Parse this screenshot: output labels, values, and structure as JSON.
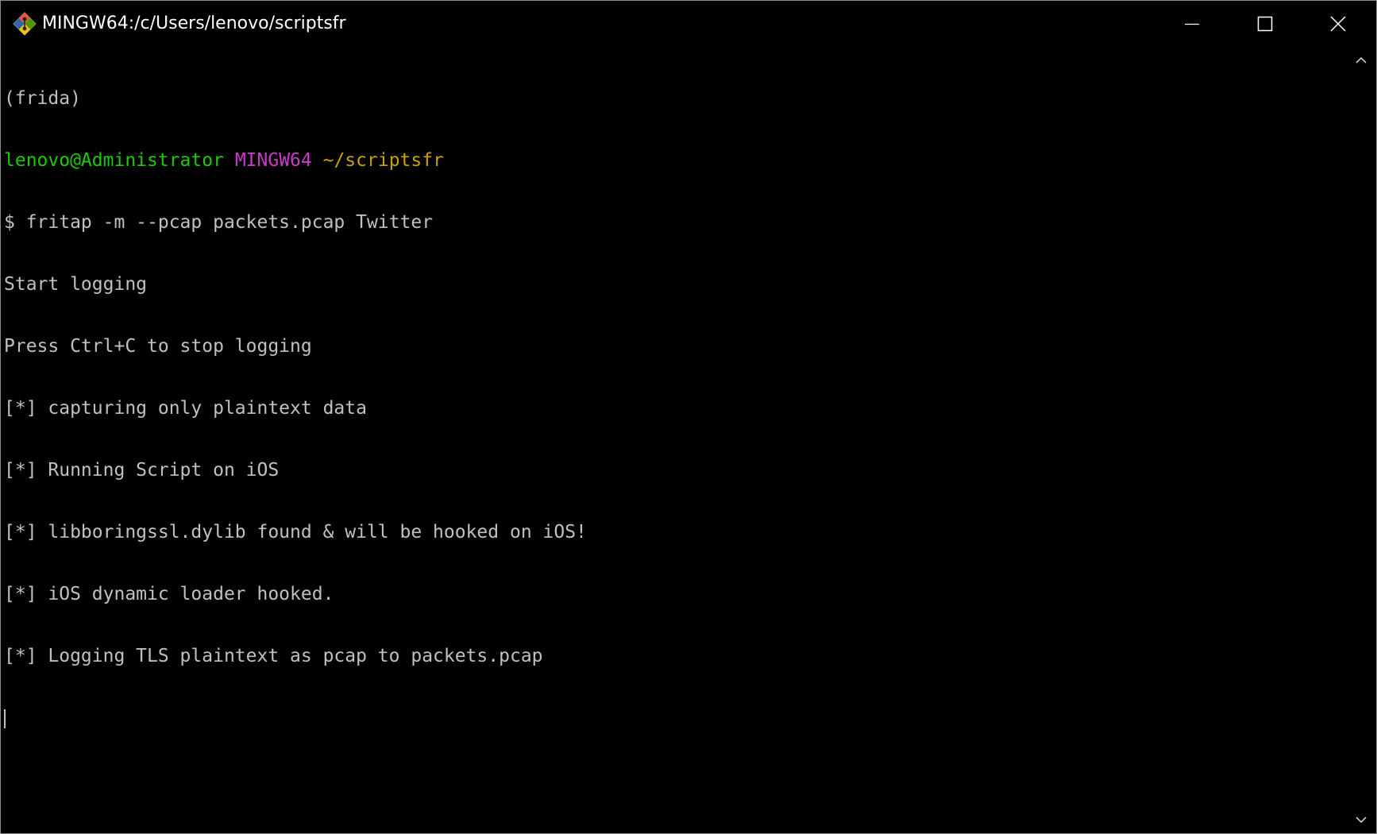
{
  "window": {
    "title": "MINGW64:/c/Users/lenovo/scriptsfr",
    "icon": "git-bash-icon",
    "controls": [
      "minimize-icon",
      "maximize-icon",
      "close-icon"
    ]
  },
  "terminal": {
    "env_line": "(frida)",
    "prompt": {
      "user_host": "lenovo@Administrator",
      "system": "MINGW64",
      "path": "~/scriptsfr"
    },
    "command_line": "$ fritap -m --pcap packets.pcap Twitter",
    "output": [
      "Start logging",
      "Press Ctrl+C to stop logging",
      "[*] capturing only plaintext data",
      "[*] Running Script on iOS",
      "[*] libboringssl.dylib found & will be hooked on iOS!",
      "[*] iOS dynamic loader hooked.",
      "[*] Logging TLS plaintext as pcap to packets.pcap"
    ]
  },
  "colors": {
    "background": "#000000",
    "text": "#c0c0c0",
    "user_host": "#19cb00",
    "system": "#c83cc8",
    "path": "#c8a000"
  }
}
